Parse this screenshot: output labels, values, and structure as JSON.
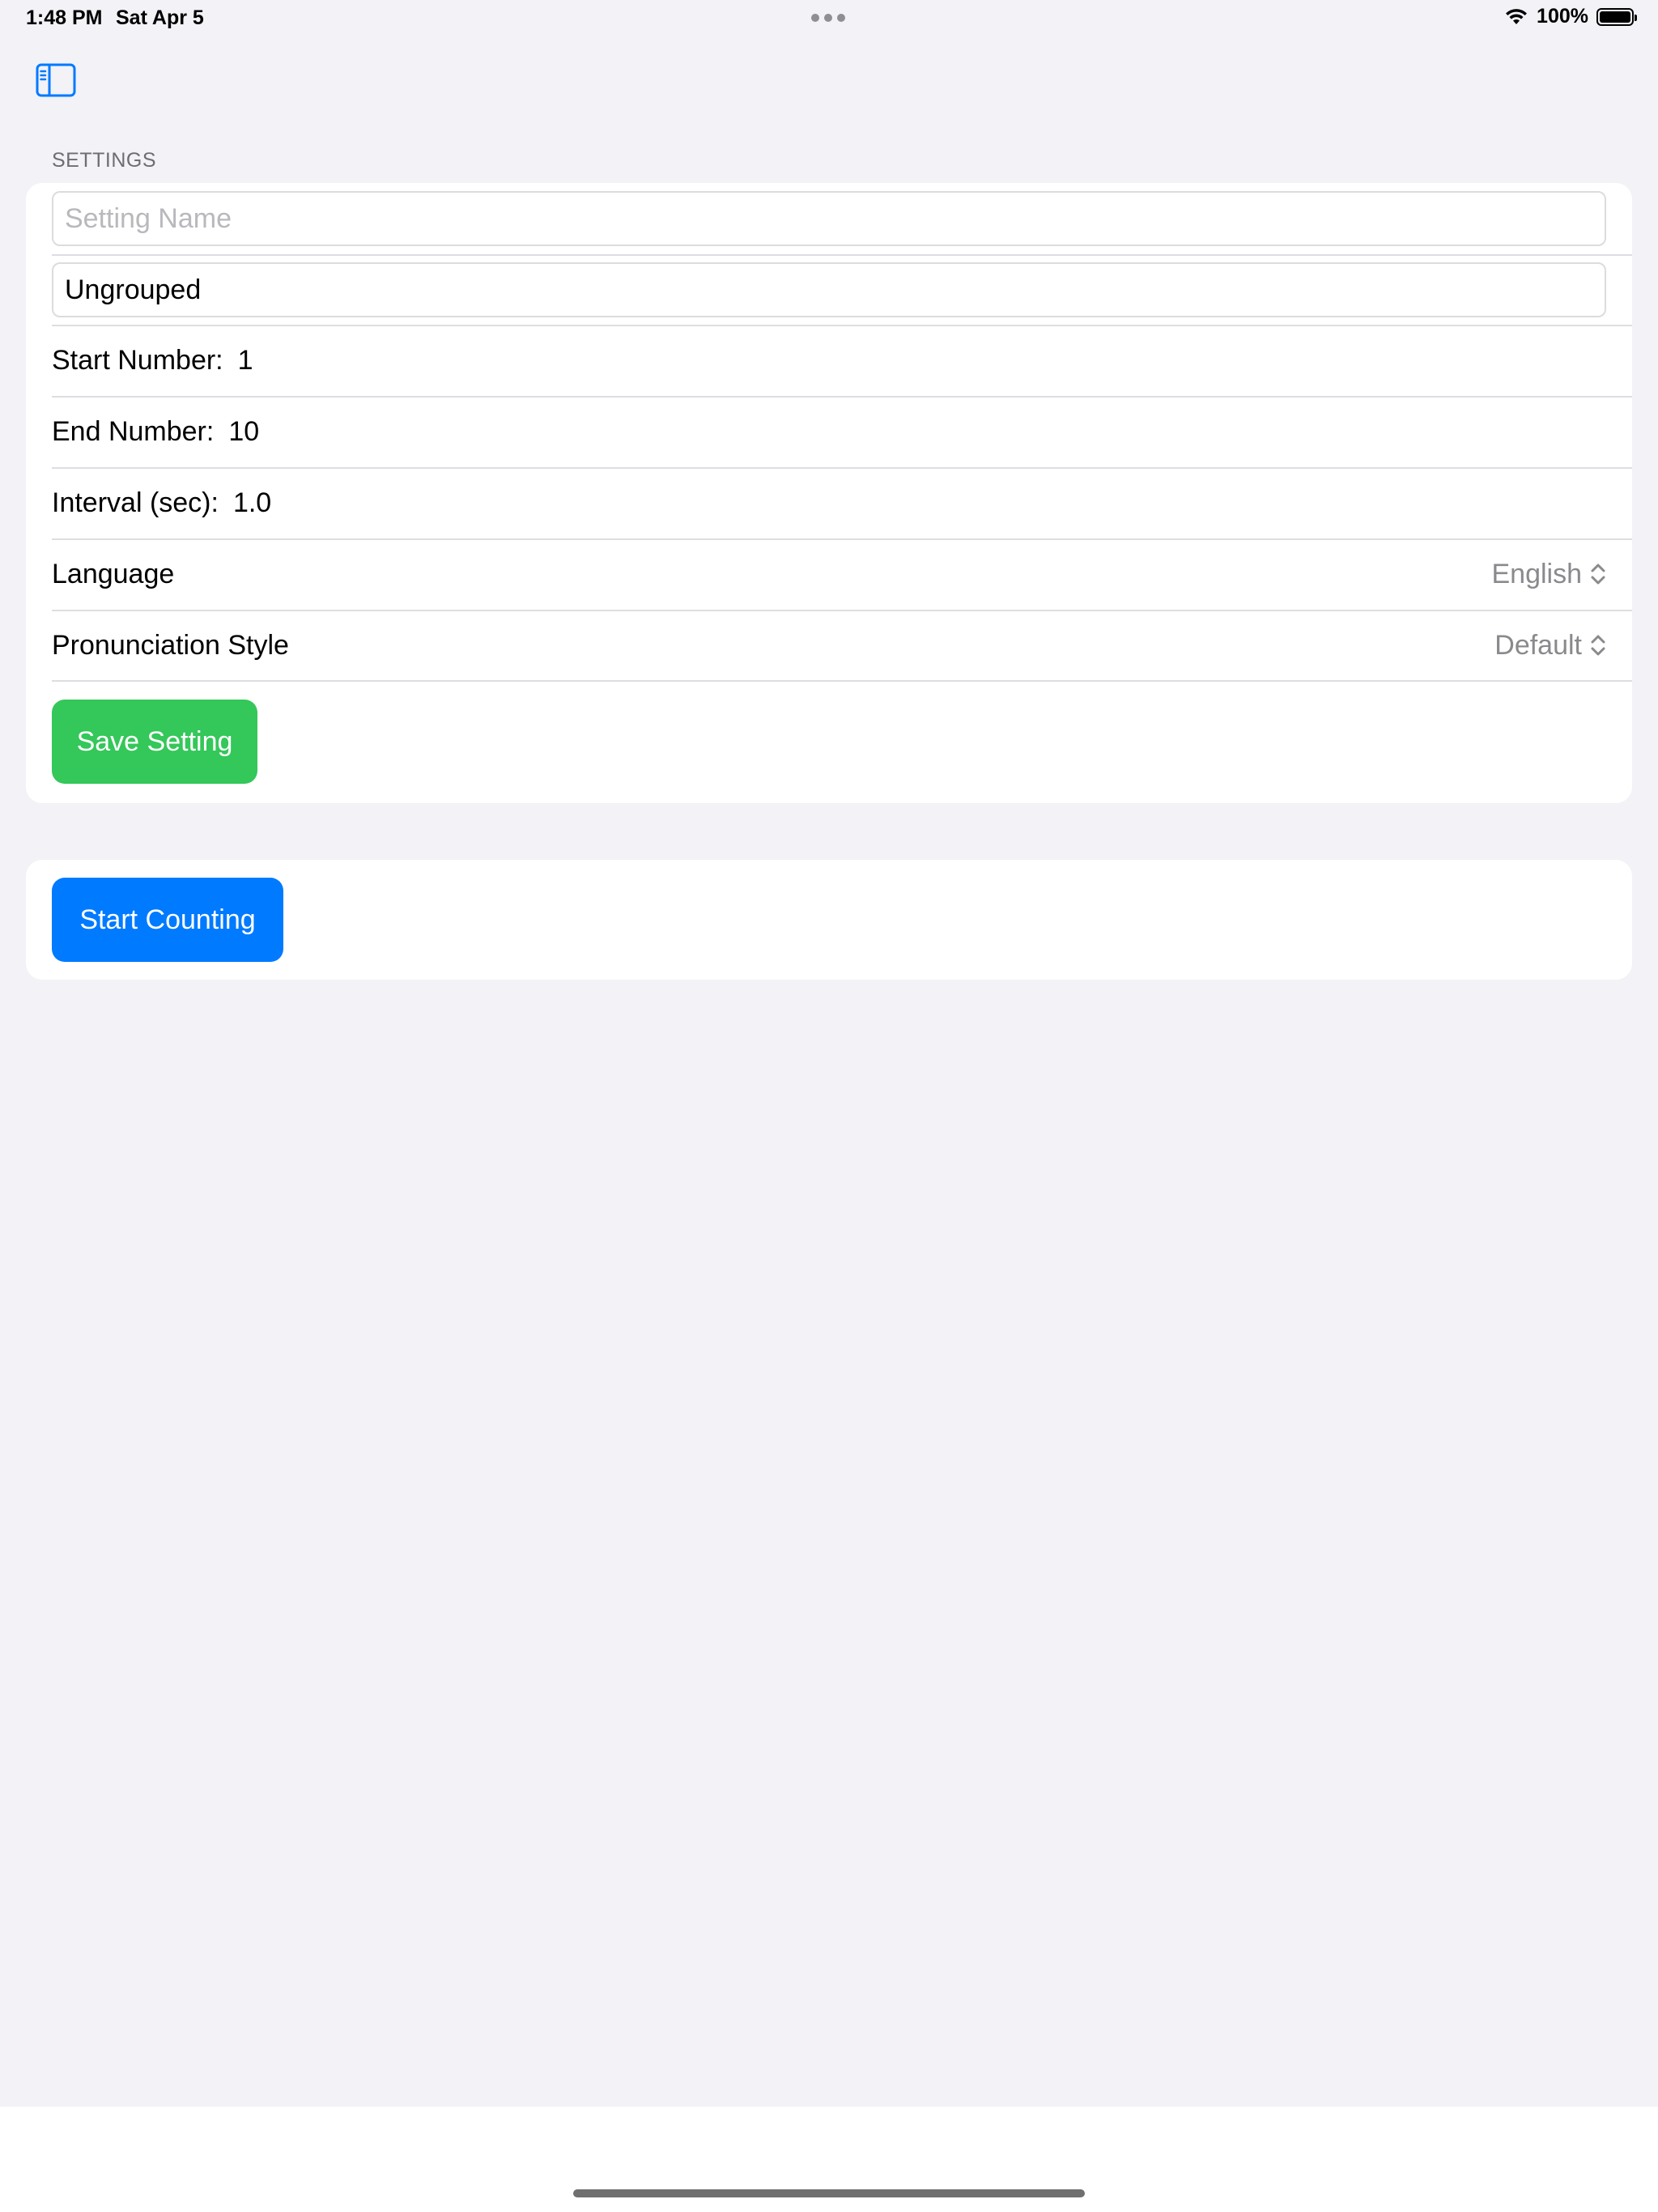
{
  "status_bar": {
    "time": "1:48 PM",
    "date": "Sat Apr 5",
    "battery_percent": "100%",
    "battery_level": 1.0
  },
  "toolbar": {
    "sidebar_icon": "sidebar-left-icon",
    "accent_color": "#007aff"
  },
  "settings": {
    "section_header": "SETTINGS",
    "name_field": {
      "value": "",
      "placeholder": "Setting Name"
    },
    "group_field": {
      "value": "Ungrouped",
      "placeholder": ""
    },
    "start_number": {
      "label": "Start Number:",
      "value": "1"
    },
    "end_number": {
      "label": "End Number:",
      "value": "10"
    },
    "interval": {
      "label": "Interval (sec):",
      "value": "1.0"
    },
    "language": {
      "label": "Language",
      "selected": "English"
    },
    "pronunciation": {
      "label": "Pronunciation Style",
      "selected": "Default"
    },
    "save_button": {
      "label": "Save Setting",
      "color": "#34c759"
    }
  },
  "actions": {
    "start_button": {
      "label": "Start Counting",
      "color": "#007aff"
    }
  },
  "colors": {
    "background": "#f2f2f7",
    "card": "#ffffff",
    "secondary_text": "#8a8a8e"
  }
}
